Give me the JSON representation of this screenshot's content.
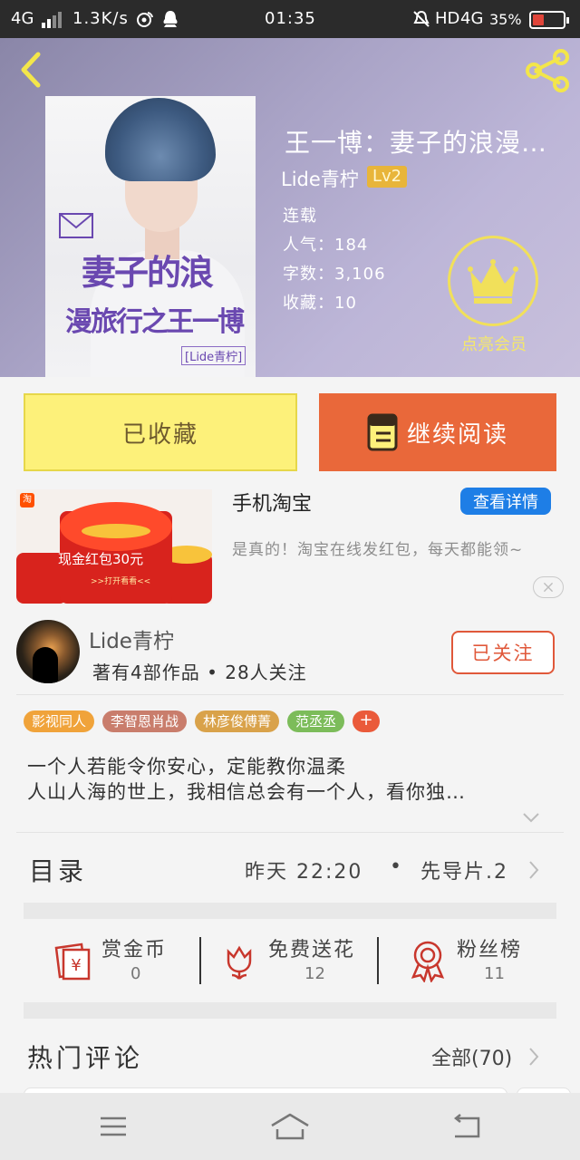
{
  "status_bar": {
    "network_left": "4G",
    "speed": "1.3K/s",
    "time": "01:35",
    "hd": "HD",
    "network_right": "4G",
    "battery": "35%"
  },
  "book": {
    "title": "王一博：妻子的浪漫…",
    "author": "Lide青柠",
    "level": "Lv2",
    "status": "连载",
    "popularity": "人气：184",
    "word_count": "字数：3,106",
    "collections": "收藏：10",
    "cover": {
      "title_line1": "妻子的浪",
      "title_line2": "漫旅行之王一博",
      "author_tag": "[Lide青柠]"
    }
  },
  "vip": {
    "label": "点亮会员"
  },
  "actions": {
    "favorited_label": "已收藏",
    "continue_label": "继续阅读"
  },
  "ad": {
    "title": "手机淘宝",
    "detail_label": "查看详情",
    "description": "是真的！淘宝在线发红包，每天都能领~",
    "image_text": "现金红包30元",
    "image_subtext": ">>打开看看<<",
    "logo_text": "淘"
  },
  "author_card": {
    "name": "Lide青柠",
    "stats": "著有4部作品 • 28人关注",
    "follow_label": "已关注"
  },
  "tags": [
    {
      "label": "影视同人",
      "color": "#f0a33a"
    },
    {
      "label": "李智恩肖战",
      "color": "#c97d6c"
    },
    {
      "label": "林彦俊傅菁",
      "color": "#d9a24a"
    },
    {
      "label": "范丞丞",
      "color": "#7cbc5a"
    }
  ],
  "tag_more": "+",
  "intro": {
    "line1": "一个人若能令你安心，定能教你温柔",
    "line2": "人山人海的世上，我相信总会有一个人，看你独…"
  },
  "catalog": {
    "label": "目录",
    "updated": "昨天 22:20",
    "separator": "•",
    "latest": "先导片.2"
  },
  "stats": [
    {
      "label": "赏金币",
      "value": "0",
      "icon": "coin-envelope-icon"
    },
    {
      "label": "免费送花",
      "value": "12",
      "icon": "flower-icon"
    },
    {
      "label": "粉丝榜",
      "value": "11",
      "icon": "medal-icon"
    }
  ],
  "comments": {
    "label": "热门评论",
    "all_label": "全部(70)"
  },
  "colors": {
    "accent_orange": "#e9683a",
    "favorite_yellow": "#fdf17a",
    "link_blue": "#1e7ee6",
    "vip_gold": "#f1e05a"
  }
}
